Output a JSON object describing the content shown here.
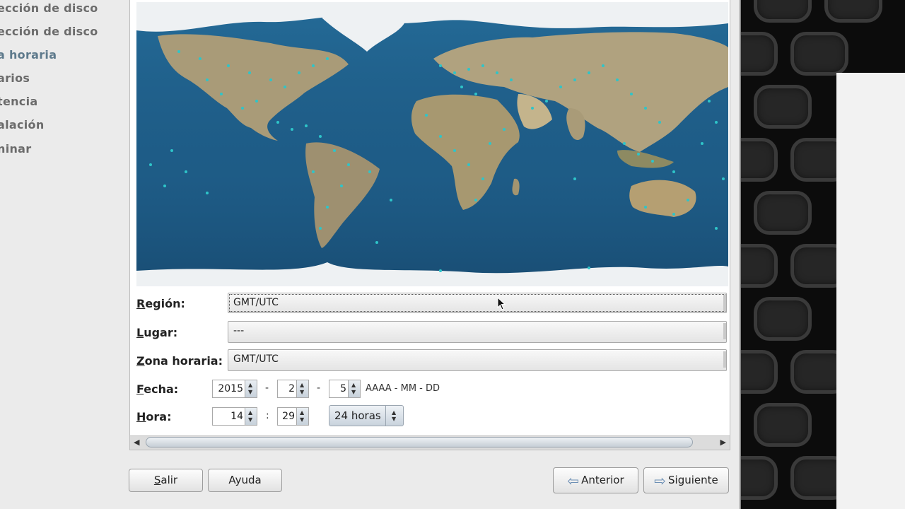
{
  "sidebar": {
    "steps": [
      {
        "label": "ección de disco"
      },
      {
        "label": "ección de disco"
      },
      {
        "label": "a horaria"
      },
      {
        "label": "arios"
      },
      {
        "label": "tencia"
      },
      {
        "label": "alación"
      },
      {
        "label": "ninar"
      }
    ]
  },
  "form": {
    "region": {
      "label": "Región:",
      "value": "GMT/UTC"
    },
    "lugar": {
      "label": "Lugar:",
      "value": "---"
    },
    "zona": {
      "label": "Zona horaria:",
      "value": "GMT/UTC"
    },
    "fecha": {
      "label": "Fecha:",
      "year": "2015",
      "month": "2",
      "day": "5",
      "sep": "-",
      "format": "AAAA - MM - DD"
    },
    "hora": {
      "label": "Hora:",
      "hour": "14",
      "minute": "29",
      "sep": ":",
      "mode": "24 horas"
    }
  },
  "buttons": {
    "salir": "Salir",
    "ayuda": "Ayuda",
    "anterior": "Anterior",
    "siguiente": "Siguiente"
  },
  "colors": {
    "ocean": "#1f5f8a",
    "land": "#a99b78",
    "ice": "#eef1f3",
    "city_dot": "#2ec5c9"
  }
}
